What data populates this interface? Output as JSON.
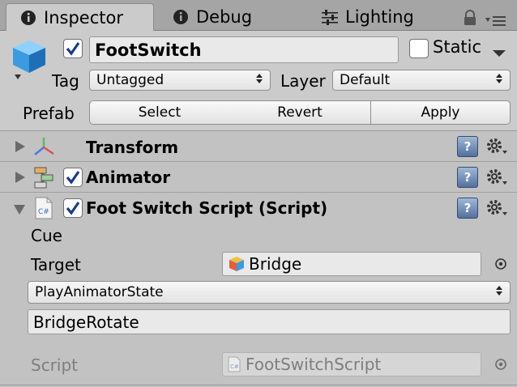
{
  "tabs": [
    {
      "label": "Inspector",
      "icon": "info-icon",
      "active": true
    },
    {
      "label": "Debug",
      "icon": "info-icon",
      "active": false
    },
    {
      "label": "Lighting",
      "icon": "sliders-icon",
      "active": false
    }
  ],
  "header": {
    "object_name": "FootSwitch",
    "active_checked": true,
    "static_label": "Static",
    "static_checked": false,
    "tag_label": "Tag",
    "tag_value": "Untagged",
    "layer_label": "Layer",
    "layer_value": "Default",
    "prefab_label": "Prefab",
    "prefab_buttons": {
      "select": "Select",
      "revert": "Revert",
      "apply": "Apply"
    }
  },
  "components": {
    "transform": {
      "title": "Transform"
    },
    "animator": {
      "title": "Animator",
      "enabled": true
    },
    "script": {
      "title": "Foot Switch Script (Script)",
      "enabled": true
    }
  },
  "script_fields": {
    "cue_label": "Cue",
    "target_label": "Target",
    "target_value": "Bridge",
    "method_value": "PlayAnimatorState",
    "state_value": "BridgeRotate",
    "script_label": "Script",
    "script_value": "FootSwitchScript"
  },
  "colors": {
    "panel_bg": "#c2c2c2",
    "header_bg": "#cbcbcb",
    "tabbar_bg": "#a5a5a5",
    "cube_blue": "#3b9be0"
  }
}
